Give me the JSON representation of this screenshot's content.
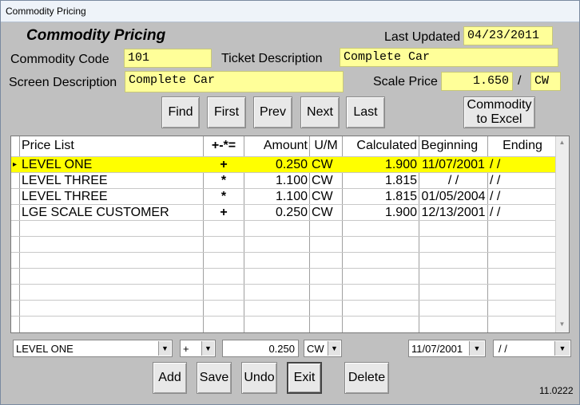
{
  "window": {
    "title": "Commodity Pricing"
  },
  "header": {
    "heading": "Commodity Pricing",
    "last_updated_label": "Last Updated",
    "last_updated_value": "04/23/2011",
    "commodity_code_label": "Commodity Code",
    "commodity_code_value": "101",
    "ticket_desc_label": "Ticket Description",
    "ticket_desc_value": "Complete Car",
    "screen_desc_label": "Screen Description",
    "screen_desc_value": "Complete Car",
    "scale_price_label": "Scale Price",
    "scale_price_value": "1.650",
    "scale_price_sep": "/",
    "scale_price_unit": "CW"
  },
  "nav_buttons": {
    "find": "Find",
    "first": "First",
    "prev": "Prev",
    "next": "Next",
    "last": "Last"
  },
  "excel_button": {
    "line1": "Commodity",
    "line2": "to Excel"
  },
  "grid": {
    "columns": {
      "price_list": "Price List",
      "operator": "+-*=",
      "amount": "Amount",
      "um": "U/M",
      "calculated": "Calculated",
      "beginning": "Beginning",
      "ending": "Ending"
    },
    "rows": [
      {
        "price_list": "LEVEL ONE",
        "op": "+",
        "amount": "0.250",
        "um": "CW",
        "calculated": "1.900",
        "beginning": "11/07/2001",
        "ending": "/ /"
      },
      {
        "price_list": "LEVEL THREE",
        "op": "*",
        "amount": "1.100",
        "um": "CW",
        "calculated": "1.815",
        "beginning": "/ /",
        "ending": "/ /"
      },
      {
        "price_list": "LEVEL THREE",
        "op": "*",
        "amount": "1.100",
        "um": "CW",
        "calculated": "1.815",
        "beginning": "01/05/2004",
        "ending": "/ /"
      },
      {
        "price_list": "LGE SCALE CUSTOMER",
        "op": "+",
        "amount": "0.250",
        "um": "CW",
        "calculated": "1.900",
        "beginning": "12/13/2001",
        "ending": "/ /"
      }
    ],
    "selected_row_color": "#ffff00",
    "record_indicator": "▸"
  },
  "editor": {
    "price_list": "LEVEL ONE",
    "operator": "+",
    "amount": "0.250",
    "um": "CW",
    "beginning": "11/07/2001",
    "ending": "/ /"
  },
  "action_buttons": {
    "add": "Add",
    "save": "Save",
    "undo": "Undo",
    "exit": "Exit",
    "delete": "Delete"
  },
  "version": "11.0222",
  "icons": {
    "dropdown": "chevron-down-icon",
    "scroll_up": "arrow-up-icon",
    "scroll_down": "arrow-down-icon"
  }
}
